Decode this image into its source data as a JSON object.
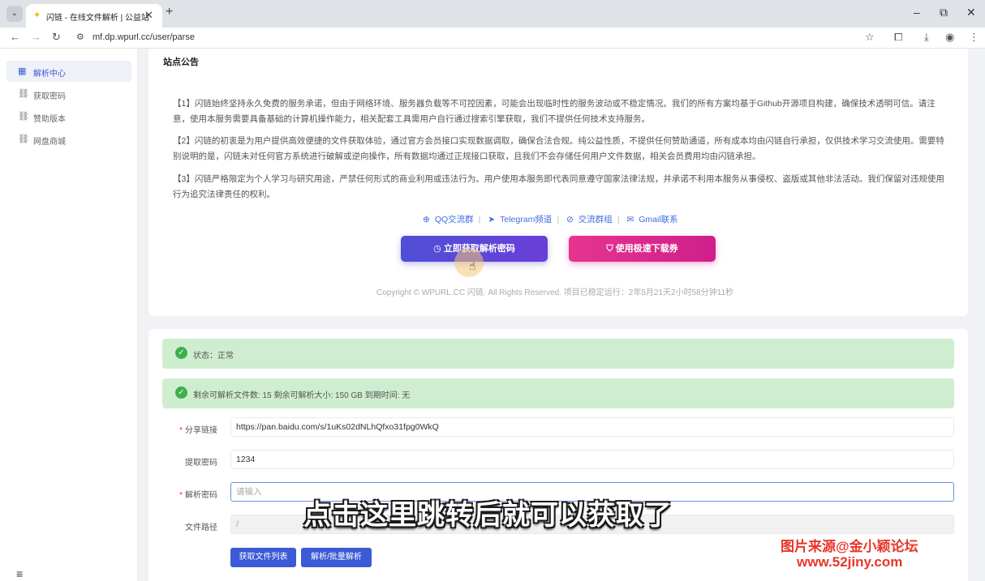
{
  "browser": {
    "tab_title": "闪链 - 在线文件解析 | 公益站",
    "url": "mf.dp.wpurl.cc/user/parse"
  },
  "sidebar": {
    "items": [
      {
        "label": "解析中心",
        "icon": "grid-icon",
        "active": true
      },
      {
        "label": "获取密码",
        "icon": "link-icon",
        "active": false
      },
      {
        "label": "赞助版本",
        "icon": "link-icon",
        "active": false
      },
      {
        "label": "网盘商城",
        "icon": "link-icon",
        "active": false
      }
    ]
  },
  "announcement": {
    "title": "站点公告",
    "paragraphs": [
      "【1】闪链始终坚持永久免费的服务承诺，但由于网络环境、服务器负载等不可控因素，可能会出现临时性的服务波动或不稳定情况。我们的所有方案均基于Github开源项目构建，确保技术透明可信。请注意，使用本服务需要具备基础的计算机操作能力，相关配套工具需用户自行通过搜索引擎获取，我们不提供任何技术支持服务。",
      "【2】闪链的初衷是为用户提供高效便捷的文件获取体验，通过官方会员接口实现数据调取，确保合法合规。纯公益性质，不提供任何赞助通道，所有成本均由闪链自行承担，仅供技术学习交流使用。需要特别说明的是，闪链未对任何官方系统进行破解或逆向操作，所有数据均通过正规接口获取，且我们不会存储任何用户文件数据，相关会员费用均由闪链承担。",
      "【3】闪链严格限定为个人学习与研究用途，严禁任何形式的商业利用或违法行为。用户使用本服务即代表同意遵守国家法律法规，并承诺不利用本服务从事侵权、盗版或其他非法活动。我们保留对违规使用行为追究法律责任的权利。"
    ],
    "links": [
      "QQ交流群",
      "Telegram频道",
      "交流群组",
      "Gmail联系"
    ],
    "primary_button": "立即获取解析密码",
    "secondary_button": "使用极速下载券",
    "copyright": "Copyright © WPURL.CC 闪链. All Rights Reserved. 项目已稳定运行：2年5月21天2小时58分钟11秒"
  },
  "parse": {
    "status_text": "状态：正常",
    "quota_text": "剩余可解析文件数: 15    剩余可解析大小: 150 GB    到期时间: 无",
    "fields": {
      "share_link_label": "分享链接",
      "share_link_value": "https://pan.baidu.com/s/1uKs02dNLhQfxo31fpg0WkQ",
      "extract_code_label": "提取密码",
      "extract_code_value": "1234",
      "parse_password_label": "解析密码",
      "parse_password_placeholder": "请输入",
      "file_path_label": "文件路径",
      "file_path_value": "/"
    },
    "buttons": {
      "get_list": "获取文件列表",
      "batch_parse": "解析/批量解析"
    }
  },
  "overlay": {
    "subtitle": "点击这里跳转后就可以获取了",
    "watermark_line1": "图片来源@金小颖论坛",
    "watermark_line2": "www.52jiny.com"
  }
}
